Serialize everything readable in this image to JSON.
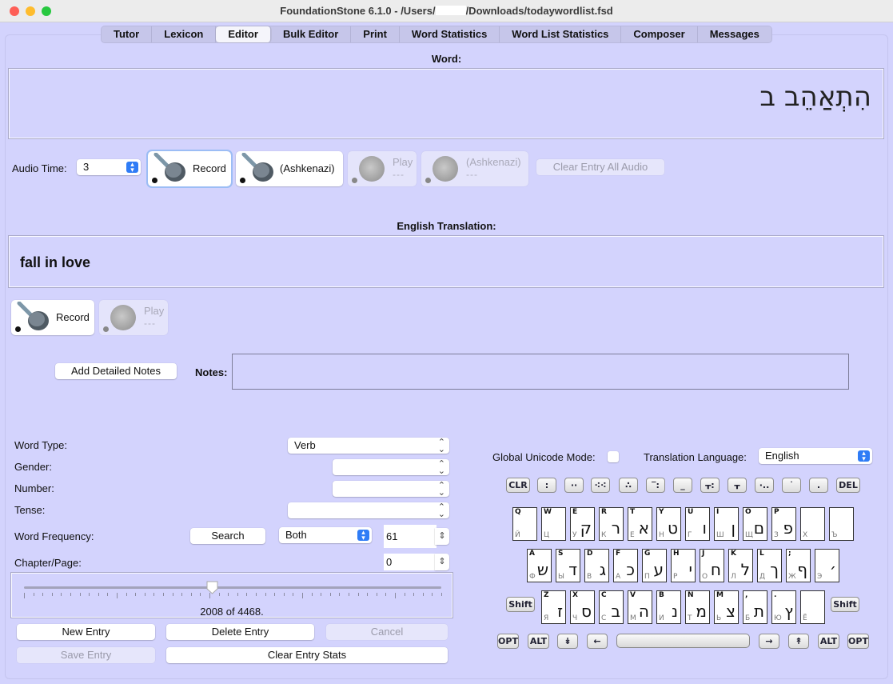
{
  "window": {
    "title_prefix": "FoundationStone 6.1.0 - /Users/",
    "title_suffix": "/Downloads/todaywordlist.fsd"
  },
  "tabs": [
    {
      "label": "Tutor"
    },
    {
      "label": "Lexicon"
    },
    {
      "label": "Editor",
      "active": true
    },
    {
      "label": "Bulk Editor"
    },
    {
      "label": "Print"
    },
    {
      "label": "Word Statistics"
    },
    {
      "label": "Word List Statistics"
    },
    {
      "label": "Composer"
    },
    {
      "label": "Messages"
    }
  ],
  "word": {
    "label": "Word:",
    "value": "הִתְאַהֵב ב"
  },
  "audio": {
    "time_label": "Audio Time:",
    "time_value": "3",
    "record_label": "Record",
    "ashkenazi_label": "(Ashkenazi)",
    "play_label": "Play",
    "play_ashkenazi_label": "(Ashkenazi)",
    "play_sub": "---",
    "clear_all_label": "Clear Entry All Audio"
  },
  "translation": {
    "label": "English Translation:",
    "value": "fall in love",
    "record_label": "Record",
    "play_label": "Play",
    "play_sub": "---"
  },
  "notes": {
    "add_detailed_label": "Add Detailed Notes",
    "label": "Notes:",
    "value": ""
  },
  "fields": {
    "word_type": {
      "label": "Word Type:",
      "value": "Verb"
    },
    "gender": {
      "label": "Gender:",
      "value": ""
    },
    "number": {
      "label": "Number:",
      "value": ""
    },
    "tense": {
      "label": "Tense:",
      "value": ""
    },
    "word_frequency": {
      "label": "Word Frequency:",
      "search_label": "Search",
      "mode": "Both",
      "value": "61"
    },
    "chapter_page": {
      "label": "Chapter/Page:",
      "value": "0"
    }
  },
  "navigator": {
    "current": 2008,
    "total": 4468,
    "text": "2008 of 4468."
  },
  "actions": {
    "new_entry": "New Entry",
    "delete_entry": "Delete Entry",
    "cancel": "Cancel",
    "save_entry": "Save Entry",
    "clear_entry_stats": "Clear Entry Stats"
  },
  "keyboard": {
    "unicode_mode_label": "Global Unicode Mode:",
    "unicode_mode_checked": false,
    "translation_language_label": "Translation Language:",
    "translation_language": "English",
    "vowel_keys": [
      {
        "name": "clear-key",
        "label": "CLR"
      },
      {
        "name": "sheva-key",
        "label": ":"
      },
      {
        "name": "tsere-key",
        "label": "··"
      },
      {
        "name": "kubutz-key",
        "label": "⁖⁖"
      },
      {
        "name": "segol-key",
        "label": "∴"
      },
      {
        "name": "hataf-patah-key",
        "label": "‾:"
      },
      {
        "name": "patah-key",
        "label": "_"
      },
      {
        "name": "hataf-kamatz-key",
        "label": "ᚁ:"
      },
      {
        "name": "kamatz-key",
        "label": "ᚁ"
      },
      {
        "name": "kubutz-diag-key",
        "label": "·.."
      },
      {
        "name": "holam-key",
        "label": "˙"
      },
      {
        "name": "hiriq-key",
        "label": "."
      },
      {
        "name": "delete-key",
        "label": "DEL"
      }
    ],
    "rows": [
      [
        {
          "en": "Q",
          "ru": "Й",
          "he": ""
        },
        {
          "en": "W",
          "ru": "Ц",
          "he": ""
        },
        {
          "en": "E",
          "ru": "У",
          "he": "ק"
        },
        {
          "en": "R",
          "ru": "К",
          "he": "ר"
        },
        {
          "en": "T",
          "ru": "Е",
          "he": "א"
        },
        {
          "en": "Y",
          "ru": "Н",
          "he": "ט"
        },
        {
          "en": "U",
          "ru": "Г",
          "he": "ו"
        },
        {
          "en": "I",
          "ru": "Ш",
          "he": "ן"
        },
        {
          "en": "O",
          "ru": "Щ",
          "he": "ם"
        },
        {
          "en": "P",
          "ru": "З",
          "he": "פ"
        },
        {
          "en": "",
          "ru": "Х",
          "he": ""
        },
        {
          "en": "",
          "ru": "Ъ",
          "he": ""
        }
      ],
      [
        {
          "en": "A",
          "ru": "Ф",
          "he": "ש"
        },
        {
          "en": "S",
          "ru": "Ы",
          "he": "ד"
        },
        {
          "en": "D",
          "ru": "В",
          "he": "ג"
        },
        {
          "en": "F",
          "ru": "А",
          "he": "כ"
        },
        {
          "en": "G",
          "ru": "П",
          "he": "ע"
        },
        {
          "en": "H",
          "ru": "Р",
          "he": "י"
        },
        {
          "en": "J",
          "ru": "О",
          "he": "ח"
        },
        {
          "en": "K",
          "ru": "Л",
          "he": "ל"
        },
        {
          "en": "L",
          "ru": "Д",
          "he": "ך"
        },
        {
          "en": ";",
          "ru": "Ж",
          "he": "ף"
        },
        {
          "en": "",
          "ru": "Э",
          "he": "׳"
        }
      ],
      [
        {
          "en": "Z",
          "ru": "Я",
          "he": "ז"
        },
        {
          "en": "X",
          "ru": "Ч",
          "he": "ס"
        },
        {
          "en": "C",
          "ru": "С",
          "he": "ב"
        },
        {
          "en": "V",
          "ru": "М",
          "he": "ה"
        },
        {
          "en": "B",
          "ru": "И",
          "he": "נ"
        },
        {
          "en": "N",
          "ru": "Т",
          "he": "מ"
        },
        {
          "en": "M",
          "ru": "Ь",
          "he": "צ"
        },
        {
          "en": ",",
          "ru": "Б",
          "he": "ת"
        },
        {
          "en": ".",
          "ru": "Ю",
          "he": "ץ"
        },
        {
          "en": "",
          "ru": "Ё",
          "he": ""
        }
      ]
    ],
    "shift_label": "Shift",
    "opt_label": "OPT",
    "alt_label": "ALT",
    "down_label": "↡",
    "left_label": "←",
    "right_label": "→",
    "up_label": "↟"
  }
}
